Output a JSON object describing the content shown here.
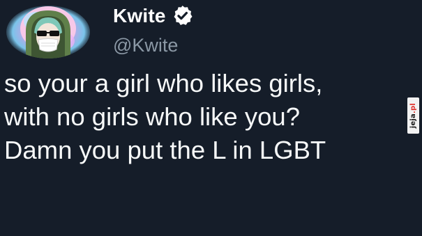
{
  "tweet": {
    "display_name": "Kwite",
    "handle": "@Kwite",
    "verified": true,
    "avatar": "avatar-cartoon-masked-hooded-figure",
    "text_lines": [
      "so your a girl who likes girls,",
      "with no girls who like you?",
      "Damn you put the L in LGBT"
    ]
  },
  "watermark": {
    "brand": "jeja",
    "domain_suffix": ".pl"
  },
  "colors": {
    "background": "#151d29",
    "text": "#f7f9f9",
    "handle": "#8b98a5",
    "verified_badge": "#ffffff",
    "watermark_accent": "#e0312c"
  },
  "icons": [
    "verified-badge-icon",
    "avatar-image"
  ]
}
